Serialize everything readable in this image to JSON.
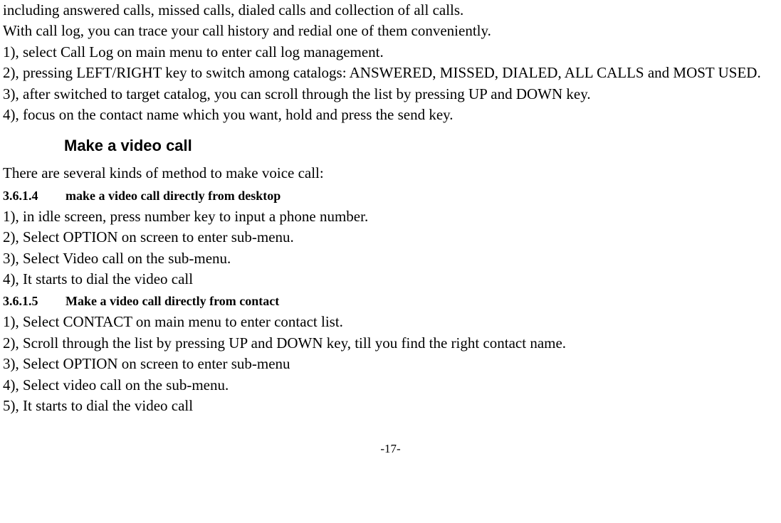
{
  "intro": {
    "p1": "including answered calls, missed calls, dialed calls and collection of all calls.",
    "p2": "With call log, you can trace your call history and redial one of them conveniently.",
    "p3": "1), select Call Log on main menu to enter call log management.",
    "p4": "2), pressing LEFT/RIGHT key to switch among catalogs: ANSWERED, MISSED, DIALED, ALL CALLS and MOST USED.",
    "p5": "3), after switched to target catalog, you can scroll through the list by pressing UP and DOWN key.",
    "p6": "4), focus on the contact name which you want, hold and press the send key."
  },
  "heading_video": "Make a video call",
  "video_intro": "There are several kinds of method to make voice call:",
  "sec1": {
    "num": "3.6.1.4",
    "title": "make a video call directly from desktop",
    "p1": "1), in idle screen, press number key to input a phone number.",
    "p2": "2), Select OPTION on screen to enter sub-menu.",
    "p3": "3), Select Video call on the sub-menu.",
    "p4": "4), It starts to dial the video call"
  },
  "sec2": {
    "num": "3.6.1.5",
    "title": "Make a video call directly from contact",
    "p1": "1), Select CONTACT on main menu to enter contact list.",
    "p2": "2), Scroll through the list by pressing UP and DOWN key, till you find the right contact name.",
    "p3": "3), Select OPTION on screen to enter sub-menu",
    "p4": "4), Select video call on the sub-menu.",
    "p5": "5), It starts to dial the video call"
  },
  "page_number": "-17-"
}
